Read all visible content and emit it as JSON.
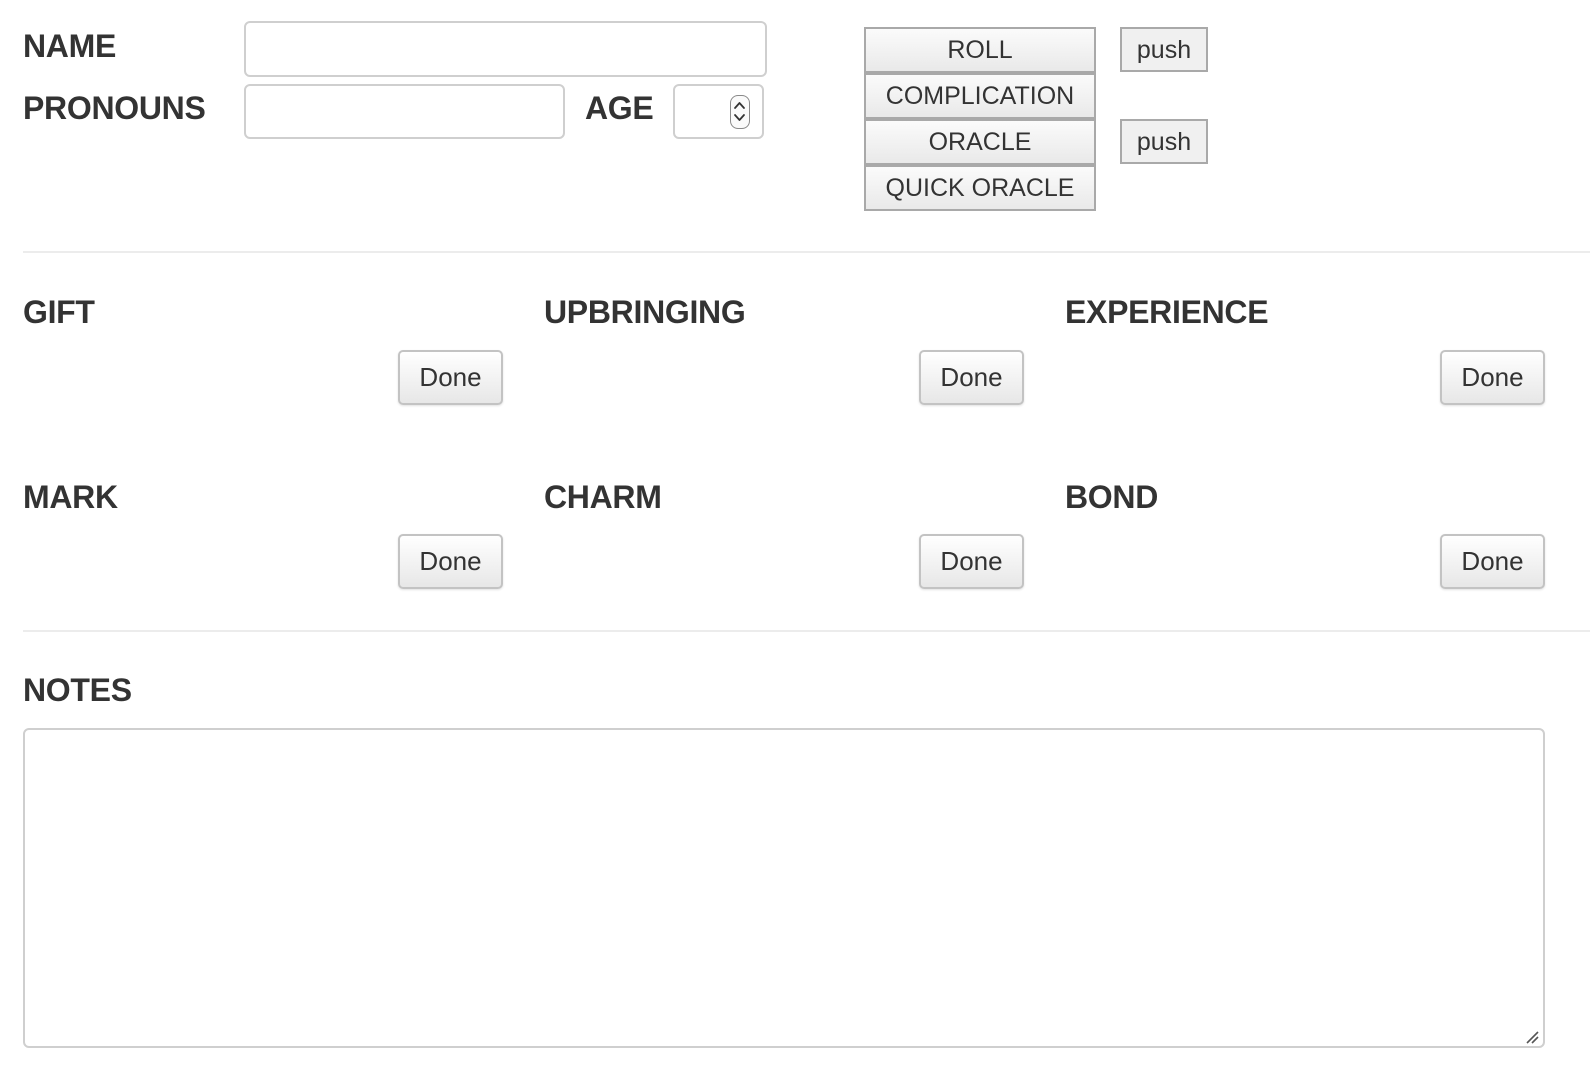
{
  "identity": {
    "name_label": "NAME",
    "name_value": "",
    "pronouns_label": "PRONOUNS",
    "pronouns_value": "",
    "age_label": "AGE",
    "age_value": ""
  },
  "dice": {
    "roll_label": "ROLL",
    "complication_label": "COMPLICATION",
    "oracle_label": "ORACLE",
    "quick_oracle_label": "QUICK ORACLE",
    "push_roll_label": "push",
    "push_oracle_label": "push"
  },
  "sections": [
    {
      "label": "GIFT",
      "done_label": "Done"
    },
    {
      "label": "UPBRINGING",
      "done_label": "Done"
    },
    {
      "label": "EXPERIENCE",
      "done_label": "Done"
    },
    {
      "label": "MARK",
      "done_label": "Done"
    },
    {
      "label": "CHARM",
      "done_label": "Done"
    },
    {
      "label": "BOND",
      "done_label": "Done"
    }
  ],
  "notes": {
    "label": "NOTES",
    "value": ""
  }
}
